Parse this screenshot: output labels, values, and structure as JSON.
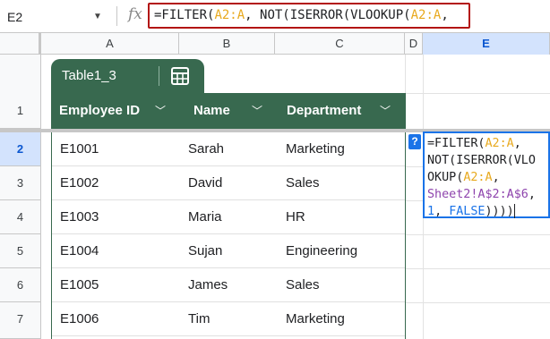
{
  "name_box": {
    "value": "E2"
  },
  "formula_bar": {
    "fx_label": "fx",
    "parts": [
      {
        "t": "=FILTER(",
        "c": ""
      },
      {
        "t": "A2:A",
        "c": "ref"
      },
      {
        "t": ", NOT(ISERROR(VLOOKUP(",
        "c": ""
      },
      {
        "t": "A2:A",
        "c": "ref"
      },
      {
        "t": ",",
        "c": ""
      }
    ]
  },
  "columns": [
    "A",
    "B",
    "C",
    "D",
    "E"
  ],
  "active_column": "E",
  "rows": [
    "1",
    "2",
    "3",
    "4",
    "5",
    "6",
    "7"
  ],
  "active_row": "2",
  "table": {
    "name": "Table1_3",
    "headers": [
      "Employee ID",
      "Name",
      "Department"
    ],
    "rows": [
      [
        "E1001",
        "Sarah",
        "Marketing"
      ],
      [
        "E1002",
        "David",
        "Sales"
      ],
      [
        "E1003",
        "Maria",
        "HR"
      ],
      [
        "E1004",
        "Sujan",
        "Engineering"
      ],
      [
        "E1005",
        "James",
        "Sales"
      ],
      [
        "E1006",
        "Tim",
        "Marketing"
      ]
    ]
  },
  "editor": {
    "help": "?",
    "lines": [
      [
        {
          "t": "=FILTER(",
          "c": ""
        },
        {
          "t": "A2:A",
          "c": "ref"
        },
        {
          "t": ",",
          "c": ""
        }
      ],
      [
        {
          "t": "NOT(ISERROR(VLO",
          "c": ""
        }
      ],
      [
        {
          "t": "OKUP(",
          "c": ""
        },
        {
          "t": "A2:A",
          "c": "ref"
        },
        {
          "t": ",",
          "c": ""
        }
      ],
      [
        {
          "t": "Sheet2!A$2:A$6",
          "c": "ref2"
        },
        {
          "t": ",",
          "c": ""
        }
      ],
      [
        {
          "t": "1",
          "c": "ref3"
        },
        {
          "t": ", ",
          "c": ""
        },
        {
          "t": "FALSE",
          "c": "ref3"
        },
        {
          "t": "))))",
          "c": ""
        }
      ]
    ]
  },
  "colors": {
    "table_header_bg": "#38694f",
    "formula_border": "#b31412",
    "active_blue": "#1a73e8",
    "ref_orange": "#e8a91e",
    "ref_purple": "#8e44ad"
  }
}
